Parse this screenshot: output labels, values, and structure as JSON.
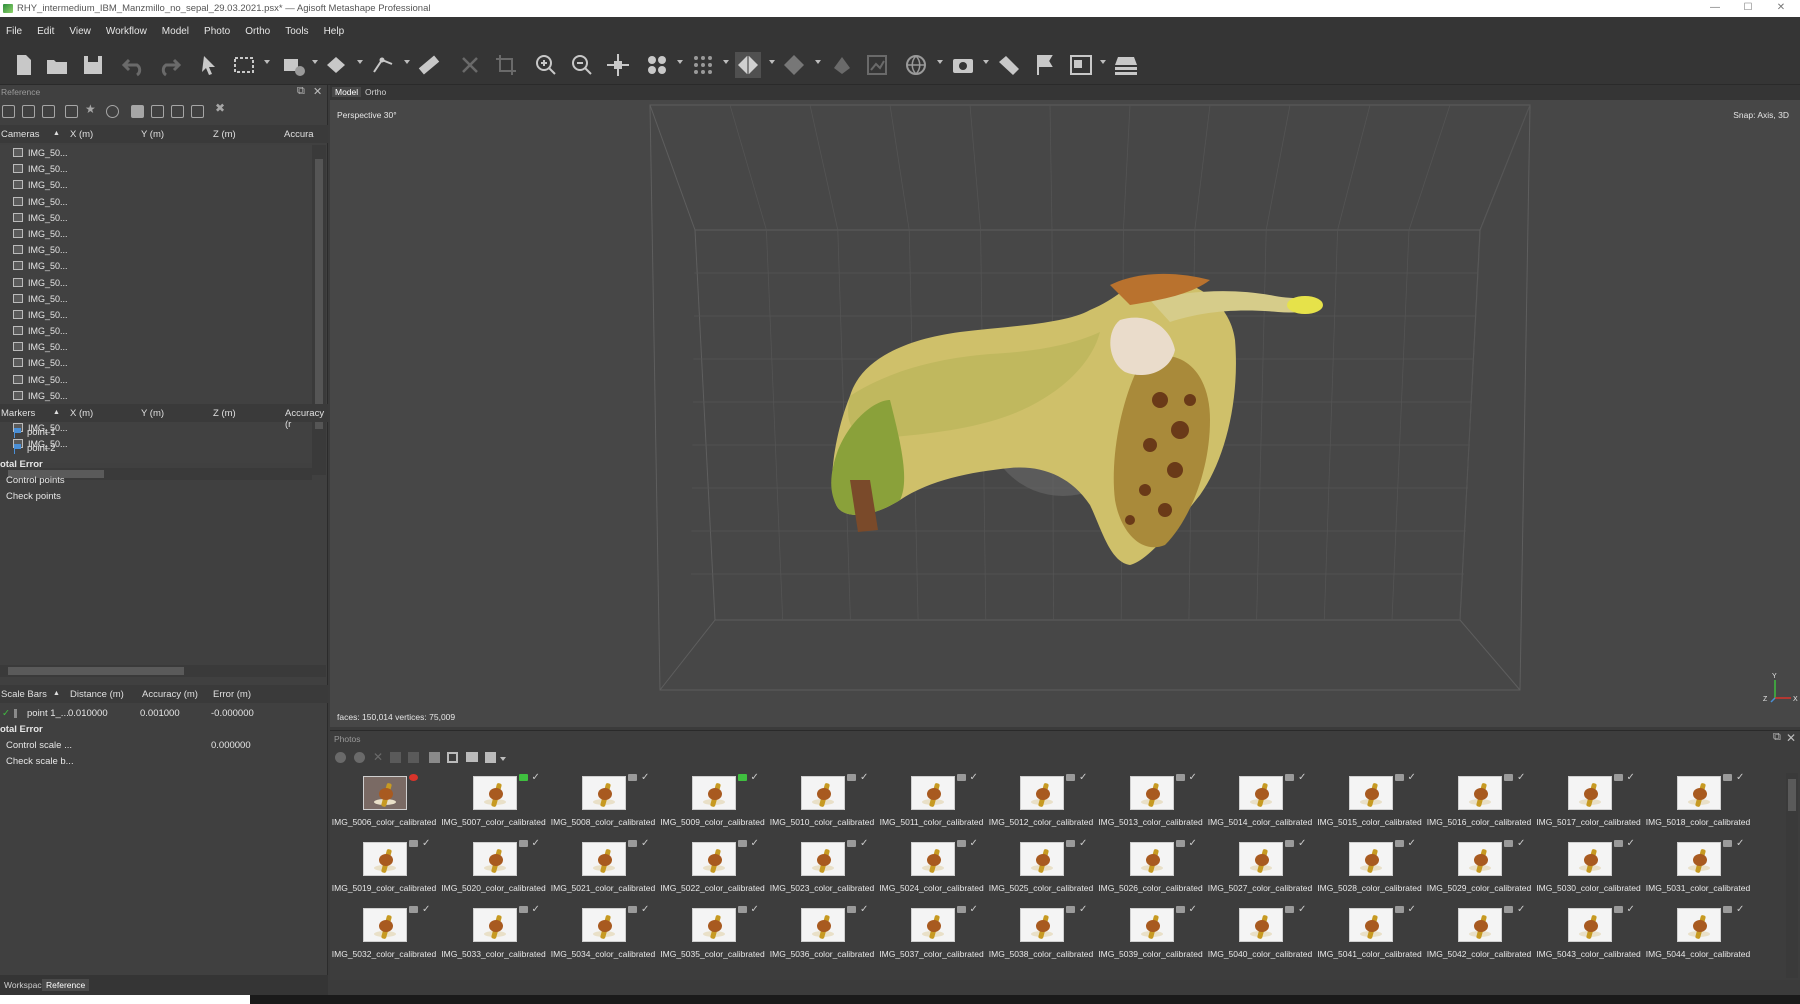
{
  "window": {
    "title": "RHY_intermedium_IBM_Manzmillo_no_sepal_29.03.2021.psx* — Agisoft Metashape Professional"
  },
  "menu": [
    "File",
    "Edit",
    "View",
    "Workflow",
    "Model",
    "Photo",
    "Ortho",
    "Tools",
    "Help"
  ],
  "toolbar_icons": [
    "new-document-icon",
    "open-folder-icon",
    "save-icon",
    "undo-icon",
    "redo-icon",
    "navigation-pointer-icon",
    "rectangle-selection-icon",
    "resize-region-icon",
    "rotate-model-icon",
    "measure-distance-icon",
    "ruler-icon",
    "delete-selection-icon",
    "crop-selection-icon",
    "zoom-in-icon",
    "zoom-out-icon",
    "reset-view-icon",
    "show-cameras-icon",
    "show-dense-cloud-icon",
    "model-shaded-icon",
    "model-solid-icon",
    "model-texture-icon",
    "tiled-model-icon",
    "dem-icon",
    "orthomosaic-icon",
    "capture-view-icon",
    "sphere-icon",
    "markers-flag-icon",
    "image-export-icon",
    "layers-icon"
  ],
  "left": {
    "panel_title": "Reference",
    "cameras_header": {
      "label": "Cameras",
      "x": "X (m)",
      "y": "Y (m)",
      "z": "Z (m)",
      "acc": "Accura"
    },
    "cameras": [
      "IMG_50...",
      "IMG_50...",
      "IMG_50...",
      "IMG_50...",
      "IMG_50...",
      "IMG_50...",
      "IMG_50...",
      "IMG_50...",
      "IMG_50...",
      "IMG_50...",
      "IMG_50...",
      "IMG_50...",
      "IMG_50...",
      "IMG_50...",
      "IMG_50...",
      "IMG_50...",
      "IMG_50...",
      "IMG_50...",
      "IMG_50..."
    ],
    "markers_header": {
      "label": "Markers",
      "x": "X (m)",
      "y": "Y (m)",
      "z": "Z (m)",
      "acc": "Accuracy (r"
    },
    "markers": [
      "point 1",
      "point 2"
    ],
    "total_error": "otal Error",
    "control_points": "Control points",
    "check_points": "Check points",
    "scalebars_header": {
      "label": "Scale Bars",
      "dist": "Distance (m)",
      "acc": "Accuracy (m)",
      "err": "Error (m)"
    },
    "scalebar_row": {
      "name": "point 1_...",
      "distance": "0.010000",
      "accuracy": "0.001000",
      "error": "-0.000000"
    },
    "sb_total_error": "otal Error",
    "control_scale": "Control scale ...",
    "control_scale_value": "0.000000",
    "check_scale": "Check scale b...",
    "tabs": [
      "Workspace",
      "Reference"
    ]
  },
  "view": {
    "tabs": [
      "Model",
      "Ortho"
    ],
    "projection": "Perspective 30°",
    "snap": "Snap: Axis, 3D",
    "stats": "faces: 150,014 vertices: 75,009",
    "axis_labels": {
      "y": "Y",
      "z": "Z",
      "x": "X"
    }
  },
  "photos": {
    "title": "Photos",
    "items": [
      "IMG_5006_color_calibrated",
      "IMG_5007_color_calibrated",
      "IMG_5008_color_calibrated",
      "IMG_5009_color_calibrated",
      "IMG_5010_color_calibrated",
      "IMG_5011_color_calibrated",
      "IMG_5012_color_calibrated",
      "IMG_5013_color_calibrated",
      "IMG_5014_color_calibrated",
      "IMG_5015_color_calibrated",
      "IMG_5016_color_calibrated",
      "IMG_5017_color_calibrated",
      "IMG_5018_color_calibrated",
      "IMG_5019_color_calibrated",
      "IMG_5020_color_calibrated",
      "IMG_5021_color_calibrated",
      "IMG_5022_color_calibrated",
      "IMG_5023_color_calibrated",
      "IMG_5024_color_calibrated",
      "IMG_5025_color_calibrated",
      "IMG_5026_color_calibrated",
      "IMG_5027_color_calibrated",
      "IMG_5028_color_calibrated",
      "IMG_5029_color_calibrated",
      "IMG_5030_color_calibrated",
      "IMG_5031_color_calibrated",
      "IMG_5032_color_calibrated",
      "IMG_5033_color_calibrated",
      "IMG_5034_color_calibrated",
      "IMG_5035_color_calibrated",
      "IMG_5036_color_calibrated",
      "IMG_5037_color_calibrated",
      "IMG_5038_color_calibrated",
      "IMG_5039_color_calibrated",
      "IMG_5040_color_calibrated",
      "IMG_5041_color_calibrated",
      "IMG_5042_color_calibrated",
      "IMG_5043_color_calibrated",
      "IMG_5044_color_calibrated"
    ]
  },
  "colors": {
    "accent": "#4a8fd6",
    "check": "#3fbf3f",
    "error": "#d9342b"
  }
}
